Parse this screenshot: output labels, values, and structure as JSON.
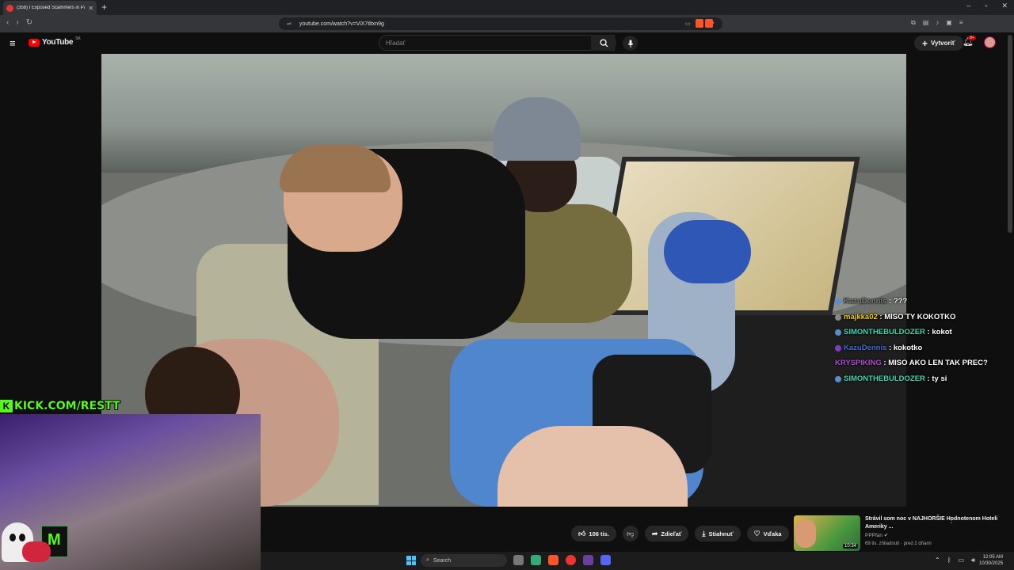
{
  "browser": {
    "tab_title": "(358) I Exposed Scammers in Pa",
    "new_tab_icon": "+",
    "url": "youtube.com/watch?v=ViX7tltxn9g",
    "window_controls": [
      "–",
      "▫",
      "✕"
    ]
  },
  "youtube": {
    "logo_text": "YouTube",
    "country_code": "SK",
    "search_placeholder": "Hľadať",
    "create_label": "Vytvoriť",
    "notification_count": "9+"
  },
  "chat": [
    {
      "user": "KazuDennis",
      "message": "???",
      "user_color": "#7c7c7c",
      "icon_color": "#5b8cc7"
    },
    {
      "user": "majkka02",
      "message": "MISO TY KOKOTKO",
      "user_color": "#f5d000",
      "icon_color": "#888888"
    },
    {
      "user": "SIMONTHEBULDOZER",
      "message": "kokot",
      "user_color": "#3fd8b0",
      "icon_color": "#5b8cc7"
    },
    {
      "user": "KazuDennis",
      "message": "kokotko",
      "user_color": "#4a6ad9",
      "icon_color": "#7a3cc2"
    },
    {
      "user": "KRYSPIKING",
      "message": "MISO AKO LEN TAK PREC?",
      "user_color": "#b54ad9",
      "icon_color": ""
    },
    {
      "user": "SIMONTHEBULDOZER",
      "message": "ty si",
      "user_color": "#3fd8b0",
      "icon_color": "#5b8cc7"
    }
  ],
  "kick_overlay": {
    "k_letter": "K",
    "text": "KICK.COM/RESTT"
  },
  "actions": {
    "like_count": "106 tis.",
    "share_label": "Zdieľať",
    "download_label": "Stiahnuť",
    "thanks_label": "Vďaka",
    "more_label": "···"
  },
  "recommendation": {
    "title": "Strávil som noc v NAJHORŠIE Hodnotenom Hoteli Ameriky ...",
    "channel": "PPPfan",
    "meta": "69 tis. zhliadnutí · pred 2 dňami",
    "duration": "10:34"
  },
  "taskbar": {
    "search_label": "Search",
    "time": "12:05 AM",
    "date": "10/30/2025"
  },
  "colors": {
    "kick_green": "#53fc18",
    "youtube_red": "#ff0000",
    "background": "#0f0f0f"
  }
}
